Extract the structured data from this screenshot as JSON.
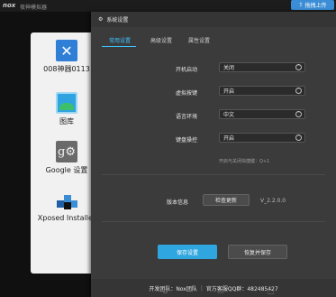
{
  "emulator": {
    "logo": "nox",
    "title": "夜神模拟器",
    "upload_label": "拖拽上传"
  },
  "launcher": {
    "apps": [
      {
        "label": "008神器0113",
        "icon": "tool-icon"
      },
      {
        "label": "图库",
        "icon": "gallery-icon"
      },
      {
        "label": "Google 设置",
        "icon": "google-settings-icon"
      },
      {
        "label": "Xposed Installer",
        "icon": "xposed-icon"
      }
    ]
  },
  "settings": {
    "title": "系统设置",
    "tabs": [
      {
        "label": "常用设置",
        "active": true
      },
      {
        "label": "高级设置",
        "active": false
      },
      {
        "label": "属性设置",
        "active": false
      }
    ],
    "rows": [
      {
        "label": "开机启动",
        "value": "关闭"
      },
      {
        "label": "虚拟按键",
        "value": "开启"
      },
      {
        "label": "语言环境",
        "value": "中文"
      },
      {
        "label": "键盘操控",
        "value": "开启"
      }
    ],
    "hint": "开启与关闭快捷键：Q+1",
    "version_label": "版本信息",
    "check_update_label": "检查更新",
    "version": "V_2.2.0.0",
    "save_label": "保存设置",
    "restore_label": "恢复并保存",
    "footer": {
      "left": "开发团队：Nox团队",
      "right": "官方客服QQ群：482485427"
    }
  },
  "colors": {
    "accent": "#3fc1ff",
    "save_button": "#2fa6df",
    "panel": "#3b3b3b"
  }
}
